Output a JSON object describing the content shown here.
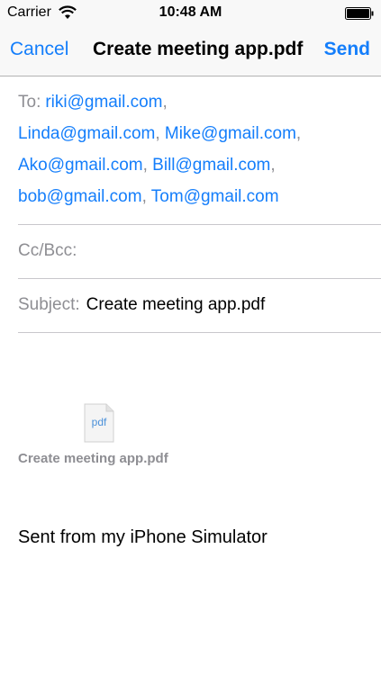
{
  "status_bar": {
    "carrier": "Carrier",
    "time": "10:48 AM"
  },
  "nav": {
    "cancel_label": "Cancel",
    "title": "Create meeting app.pdf",
    "send_label": "Send"
  },
  "compose": {
    "to_label": "To:",
    "recipients": [
      "riki@gmail.com",
      "Linda@gmail.com",
      "Mike@gmail.com",
      "Ako@gmail.com",
      "Bill@gmail.com",
      "bob@gmail.com",
      "Tom@gmail.com"
    ],
    "separator": ",",
    "cc_label": "Cc/Bcc:",
    "subject_label": "Subject:",
    "subject_value": "Create meeting app.pdf"
  },
  "attachment": {
    "icon": "pdf-file-icon",
    "icon_text": "pdf",
    "name": "Create meeting app.pdf"
  },
  "body": {
    "signature": "Sent from my iPhone Simulator"
  },
  "colors": {
    "accent": "#147efb",
    "label_gray": "#8e8e93"
  }
}
